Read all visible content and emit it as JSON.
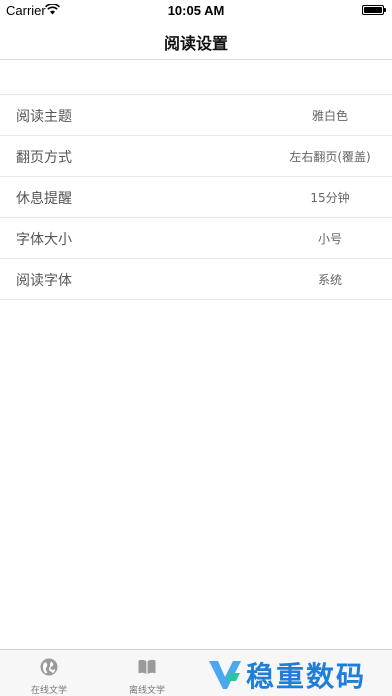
{
  "status_bar": {
    "carrier": "Carrier",
    "time": "10:05 AM"
  },
  "nav": {
    "title": "阅读设置"
  },
  "settings": {
    "rows": [
      {
        "label": "阅读主题",
        "value": "雅白色"
      },
      {
        "label": "翻页方式",
        "value": "左右翻页(覆盖)"
      },
      {
        "label": "休息提醒",
        "value": "15分钟"
      },
      {
        "label": "字体大小",
        "value": "小号"
      },
      {
        "label": "阅读字体",
        "value": "系统"
      }
    ]
  },
  "tab_bar": {
    "tabs": [
      {
        "label": "在线文学",
        "icon": "globe-icon"
      },
      {
        "label": "离线文学",
        "icon": "book-icon"
      }
    ]
  },
  "watermark": {
    "text": "稳重数码",
    "color": "#1f7fd8"
  }
}
